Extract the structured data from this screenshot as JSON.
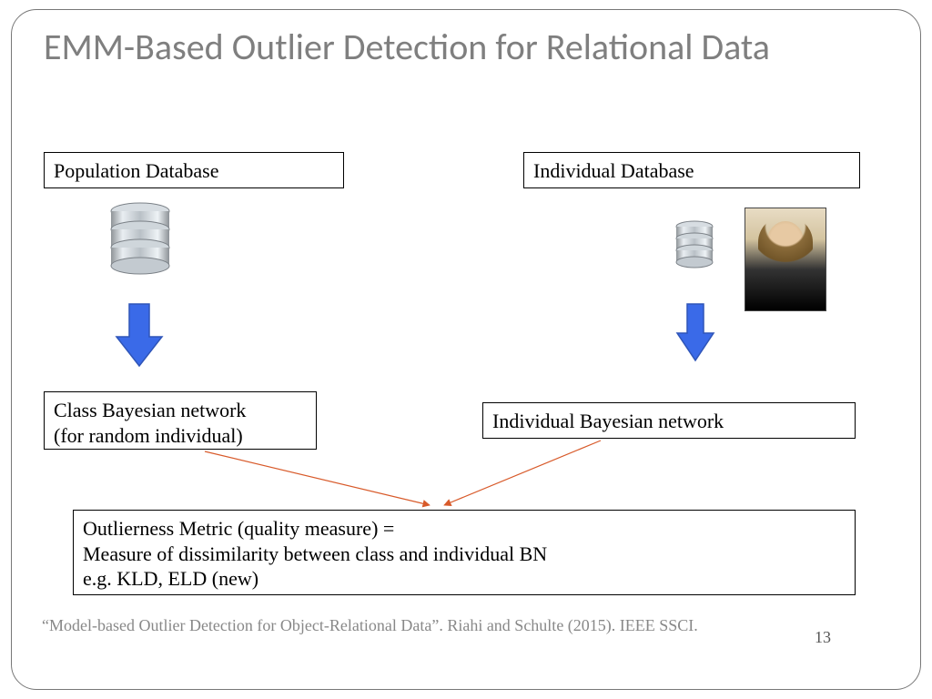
{
  "title": "EMM-Based Outlier Detection for Relational Data",
  "boxes": {
    "population_db": "Population Database",
    "individual_db": "Individual Database",
    "class_bn_line1": "Class Bayesian network",
    "class_bn_line2": "(for random individual)",
    "individual_bn": "Individual Bayesian network",
    "metric_line1": "Outlierness Metric (quality measure) =",
    "metric_line2": "Measure of dissimilarity between class and individual BN",
    "metric_line3": "e.g. KLD, ELD (new)"
  },
  "icons": {
    "db_large": "database-icon",
    "db_small": "database-icon",
    "arrow_left": "down-arrow-icon",
    "arrow_right": "down-arrow-icon",
    "photo": "person-photo"
  },
  "colors": {
    "arrow_fill": "#3a6ae8",
    "arrow_stroke": "#2f55b8",
    "thin_arrow": "#d85a2a",
    "title_color": "#7f7f7f"
  },
  "footnote": "“Model-based Outlier Detection for Object-Relational Data”. Riahi and Schulte (2015). IEEE SSCI.",
  "page_number": "13"
}
